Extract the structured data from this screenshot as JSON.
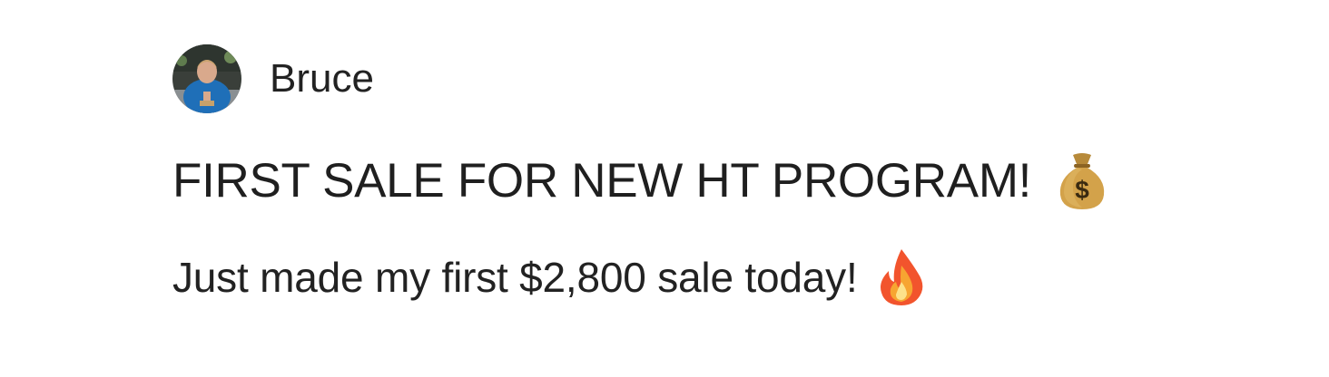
{
  "post": {
    "author": {
      "name": "Bruce",
      "avatar_icon": "avatar-photo"
    },
    "title": "FIRST SALE FOR NEW HT PROGRAM!",
    "title_emoji": "money-bag-icon",
    "body": "Just made my first $2,800 sale today!",
    "body_emoji": "fire-icon"
  }
}
